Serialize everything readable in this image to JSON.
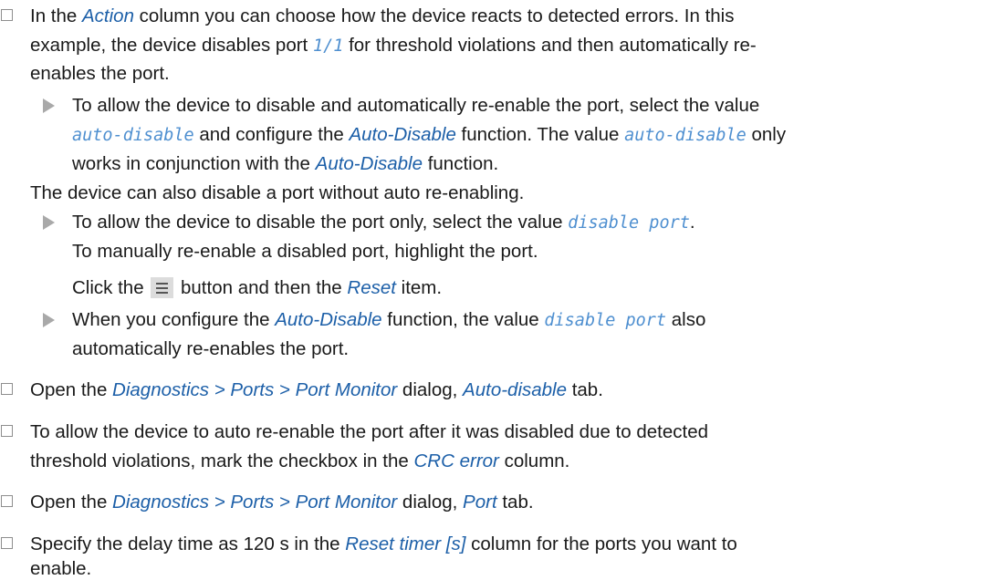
{
  "step1": {
    "l1_a": "In the ",
    "l1_b": "Action",
    "l1_c": " column you can choose how the device reacts to detected errors. In this",
    "l2_a": "example, the device disables port ",
    "l2_b": "1/1",
    "l2_c": " for threshold violations and then automatically re-",
    "l3": "enables the port."
  },
  "bullet1": {
    "l1": "To allow the device to disable and automatically re-enable the port, select the value",
    "l2_a": "auto-disable",
    "l2_b": " and configure the ",
    "l2_c": "Auto-Disable",
    "l2_d": " function. The value ",
    "l2_e": "auto-disable",
    "l2_f": " only",
    "l3_a": "works in conjunction with the ",
    "l3_b": "Auto-Disable",
    "l3_c": " function."
  },
  "note1": "The device can also disable a port without auto re-enabling.",
  "bullet2": {
    "l1_a": "To allow the device to disable the port only, select the value ",
    "l1_b": "disable port",
    "l1_c": ".",
    "l2": "To manually re-enable a disabled port, highlight the port.",
    "l3_a": "Click the ",
    "l3_b": " button and then the ",
    "l3_c": "Reset",
    "l3_d": " item."
  },
  "bullet3": {
    "l1_a": "When you configure the ",
    "l1_b": "Auto-Disable",
    "l1_c": " function, the value ",
    "l1_d": "disable port",
    "l1_e": " also",
    "l2": "automatically re-enables the port."
  },
  "step2": {
    "a": "Open the ",
    "b": "Diagnostics > Ports > Port Monitor",
    "c": " dialog, ",
    "d": "Auto-disable",
    "e": " tab."
  },
  "step3": {
    "l1": "To allow the device to auto re-enable the port after it was disabled due to detected",
    "l2_a": "threshold violations, mark the checkbox in the ",
    "l2_b": "CRC error",
    "l2_c": " column."
  },
  "step4": {
    "a": "Open the ",
    "b": "Diagnostics > Ports > Port Monitor",
    "c": " dialog, ",
    "d": "Port",
    "e": " tab."
  },
  "step5": {
    "l1_a": "Specify the delay time as 120 s in the ",
    "l1_b": "Reset timer [s]",
    "l1_c": " column for the ports you want to",
    "l2": "enable."
  },
  "icons": {
    "checkbox": "checkbox-icon",
    "bullet": "triangle-bullet-icon",
    "menu": "hamburger-menu-icon"
  }
}
